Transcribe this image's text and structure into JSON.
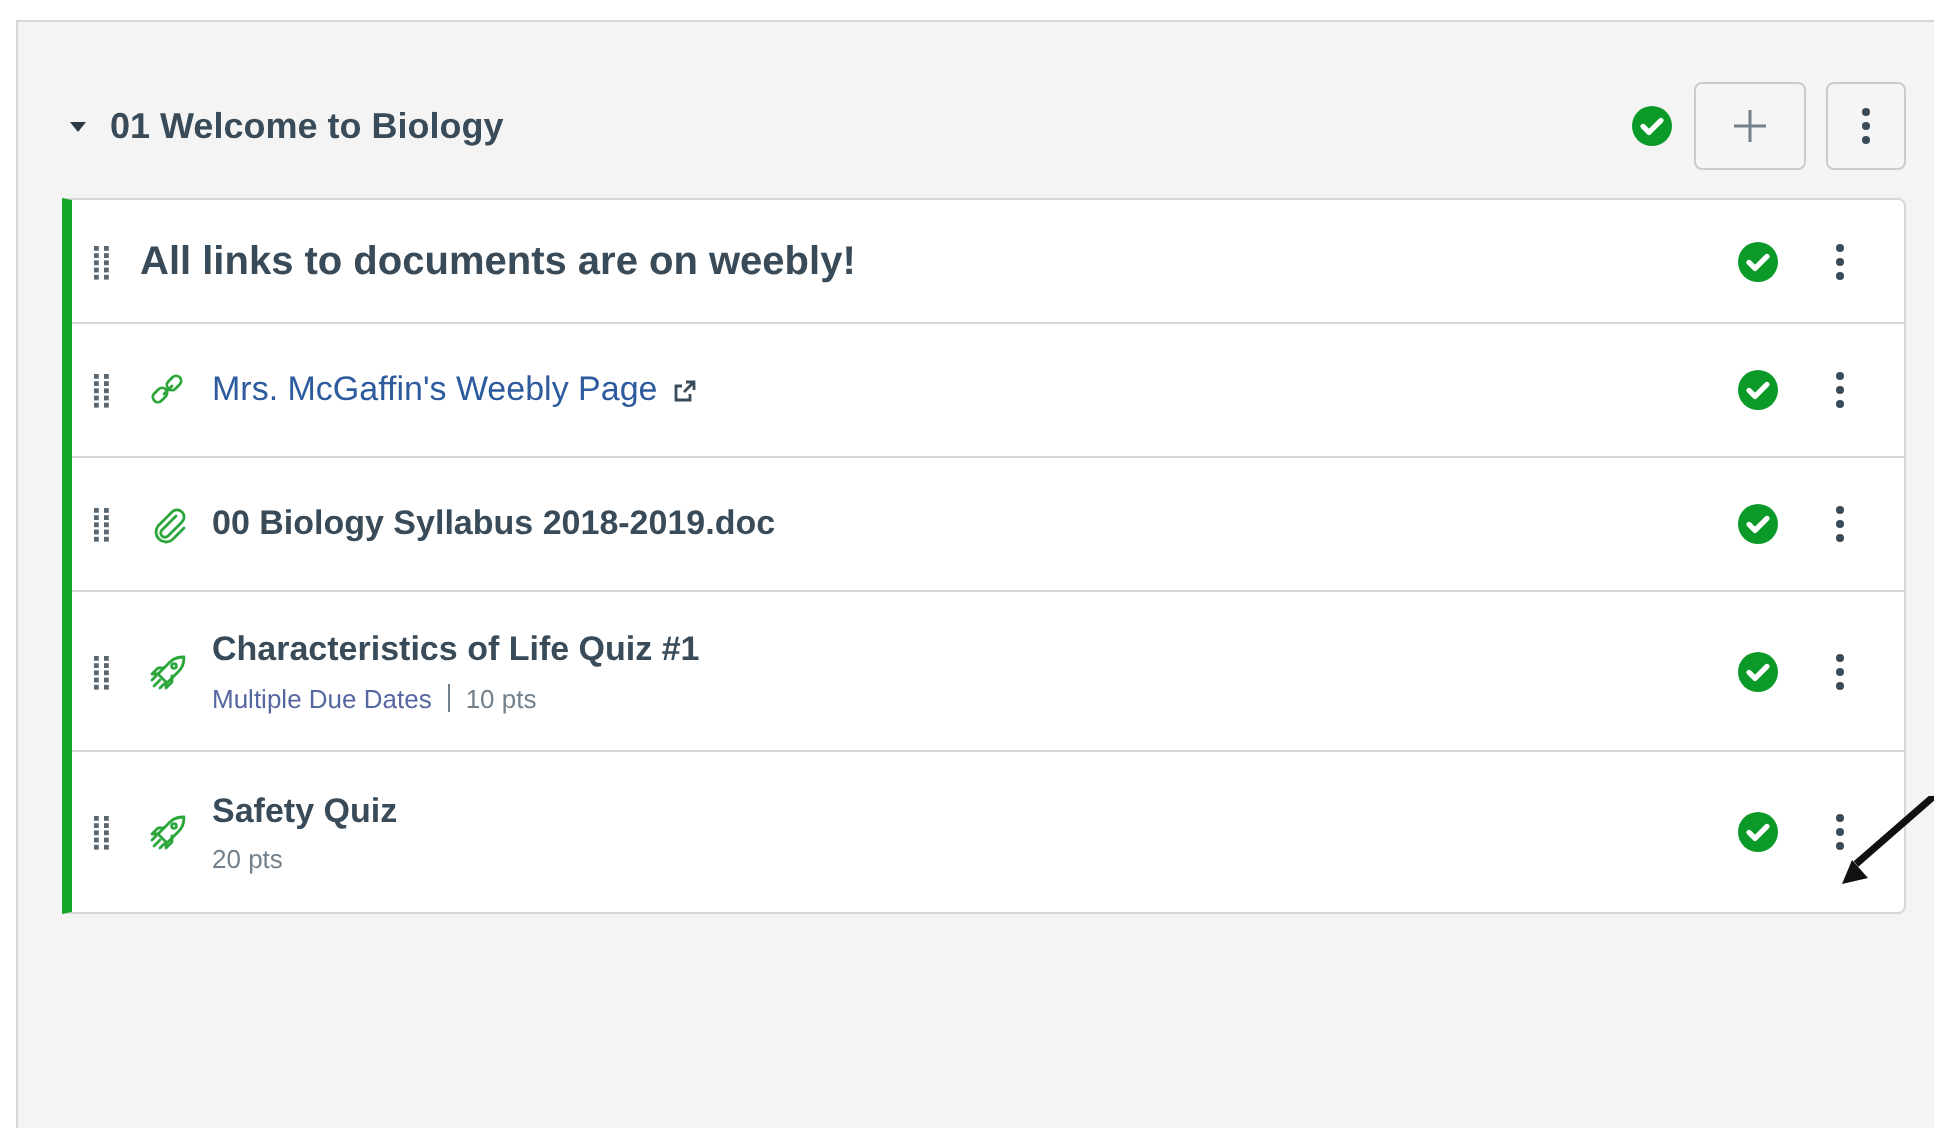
{
  "module": {
    "title": "01 Welcome to Biology",
    "expanded": true,
    "published": true,
    "items": [
      {
        "kind": "subheader",
        "title": "All links to documents are on weebly!",
        "published": true
      },
      {
        "kind": "link",
        "title": "Mrs. McGaffin's Weebly Page",
        "published": true
      },
      {
        "kind": "file",
        "title": "00 Biology Syllabus 2018-2019.doc",
        "published": true
      },
      {
        "kind": "quiz",
        "title": "Characteristics of Life Quiz #1",
        "due": "Multiple Due Dates",
        "points": "10 pts",
        "published": true
      },
      {
        "kind": "quiz",
        "title": "Safety Quiz",
        "points": "20 pts",
        "published": true
      }
    ]
  }
}
